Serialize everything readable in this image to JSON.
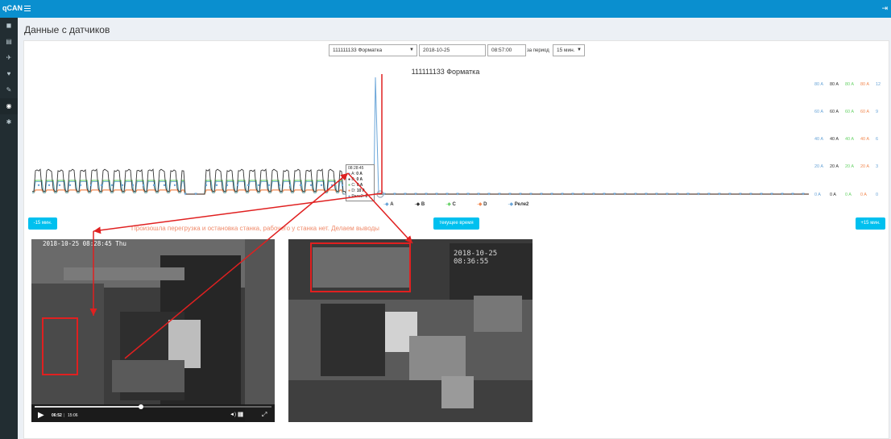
{
  "header": {
    "logo": "qCAN"
  },
  "page": {
    "title": "Данные с датчиков"
  },
  "controls": {
    "device_select": "111111133 Форматка",
    "date": "2018-10-25",
    "time": "08:57:00",
    "period_label": "за период",
    "period_select": "15 мин."
  },
  "chart_data": {
    "type": "line",
    "title": "111111133 Форматка",
    "x_range": [
      "08:42:00",
      "09:12:00"
    ],
    "yaxes": [
      {
        "series": "A",
        "color": "#6aa5d8",
        "ticks": [
          "80 A",
          "60 A",
          "40 A",
          "20 A",
          "0 A"
        ],
        "ylim": [
          0,
          80
        ]
      },
      {
        "series": "B",
        "color": "#333333",
        "ticks": [
          "80 A",
          "60 A",
          "40 A",
          "20 A",
          "0 A"
        ],
        "ylim": [
          0,
          80
        ]
      },
      {
        "series": "C",
        "color": "#6ad36a",
        "ticks": [
          "80 A",
          "60 A",
          "40 A",
          "20 A",
          "0 A"
        ],
        "ylim": [
          0,
          80
        ]
      },
      {
        "series": "D",
        "color": "#f28b54",
        "ticks": [
          "80 A",
          "60 A",
          "40 A",
          "20 A",
          "0 A"
        ],
        "ylim": [
          0,
          80
        ]
      },
      {
        "series": "Реле2",
        "color": "#6aa5d8",
        "ticks": [
          "12",
          "9",
          "6",
          "3",
          "0"
        ],
        "ylim": [
          0,
          12
        ]
      }
    ],
    "legend": [
      "A",
      "B",
      "C",
      "D",
      "Реле2"
    ],
    "legend_position": "bottom",
    "series_approx": {
      "B_active_peak": 18,
      "A_C_active_level": 10,
      "D_active_level": 3,
      "idle_value": 0
    },
    "tooltip": {
      "time": "08:28:45",
      "rows": [
        {
          "label": "A:",
          "value": "0 A",
          "color": "#6aa5d8"
        },
        {
          "label": "B:",
          "value": "0 A",
          "color": "#333333"
        },
        {
          "label": "C:",
          "value": "0 A",
          "color": "#6ad36a"
        },
        {
          "label": "D:",
          "value": "10 A",
          "color": "#f28b54"
        },
        {
          "label": "Реле2:",
          "value": "0",
          "color": "#6aa5d8"
        }
      ]
    }
  },
  "buttons": {
    "minus": "-15 мин.",
    "now": "текущее время",
    "plus": "+15 мин."
  },
  "annotation": {
    "text": "Произошла перегрузка и остановка станка, рабочего у станка нет. Делаем выводы",
    "color": "#e04040"
  },
  "videos": [
    {
      "timestamp": "2018-10-25 08:28:45 Thu",
      "time_current": "06:52",
      "time_total": "15:06",
      "progress": 0.45
    },
    {
      "timestamp": "2018-10-25 08:36:55"
    }
  ]
}
